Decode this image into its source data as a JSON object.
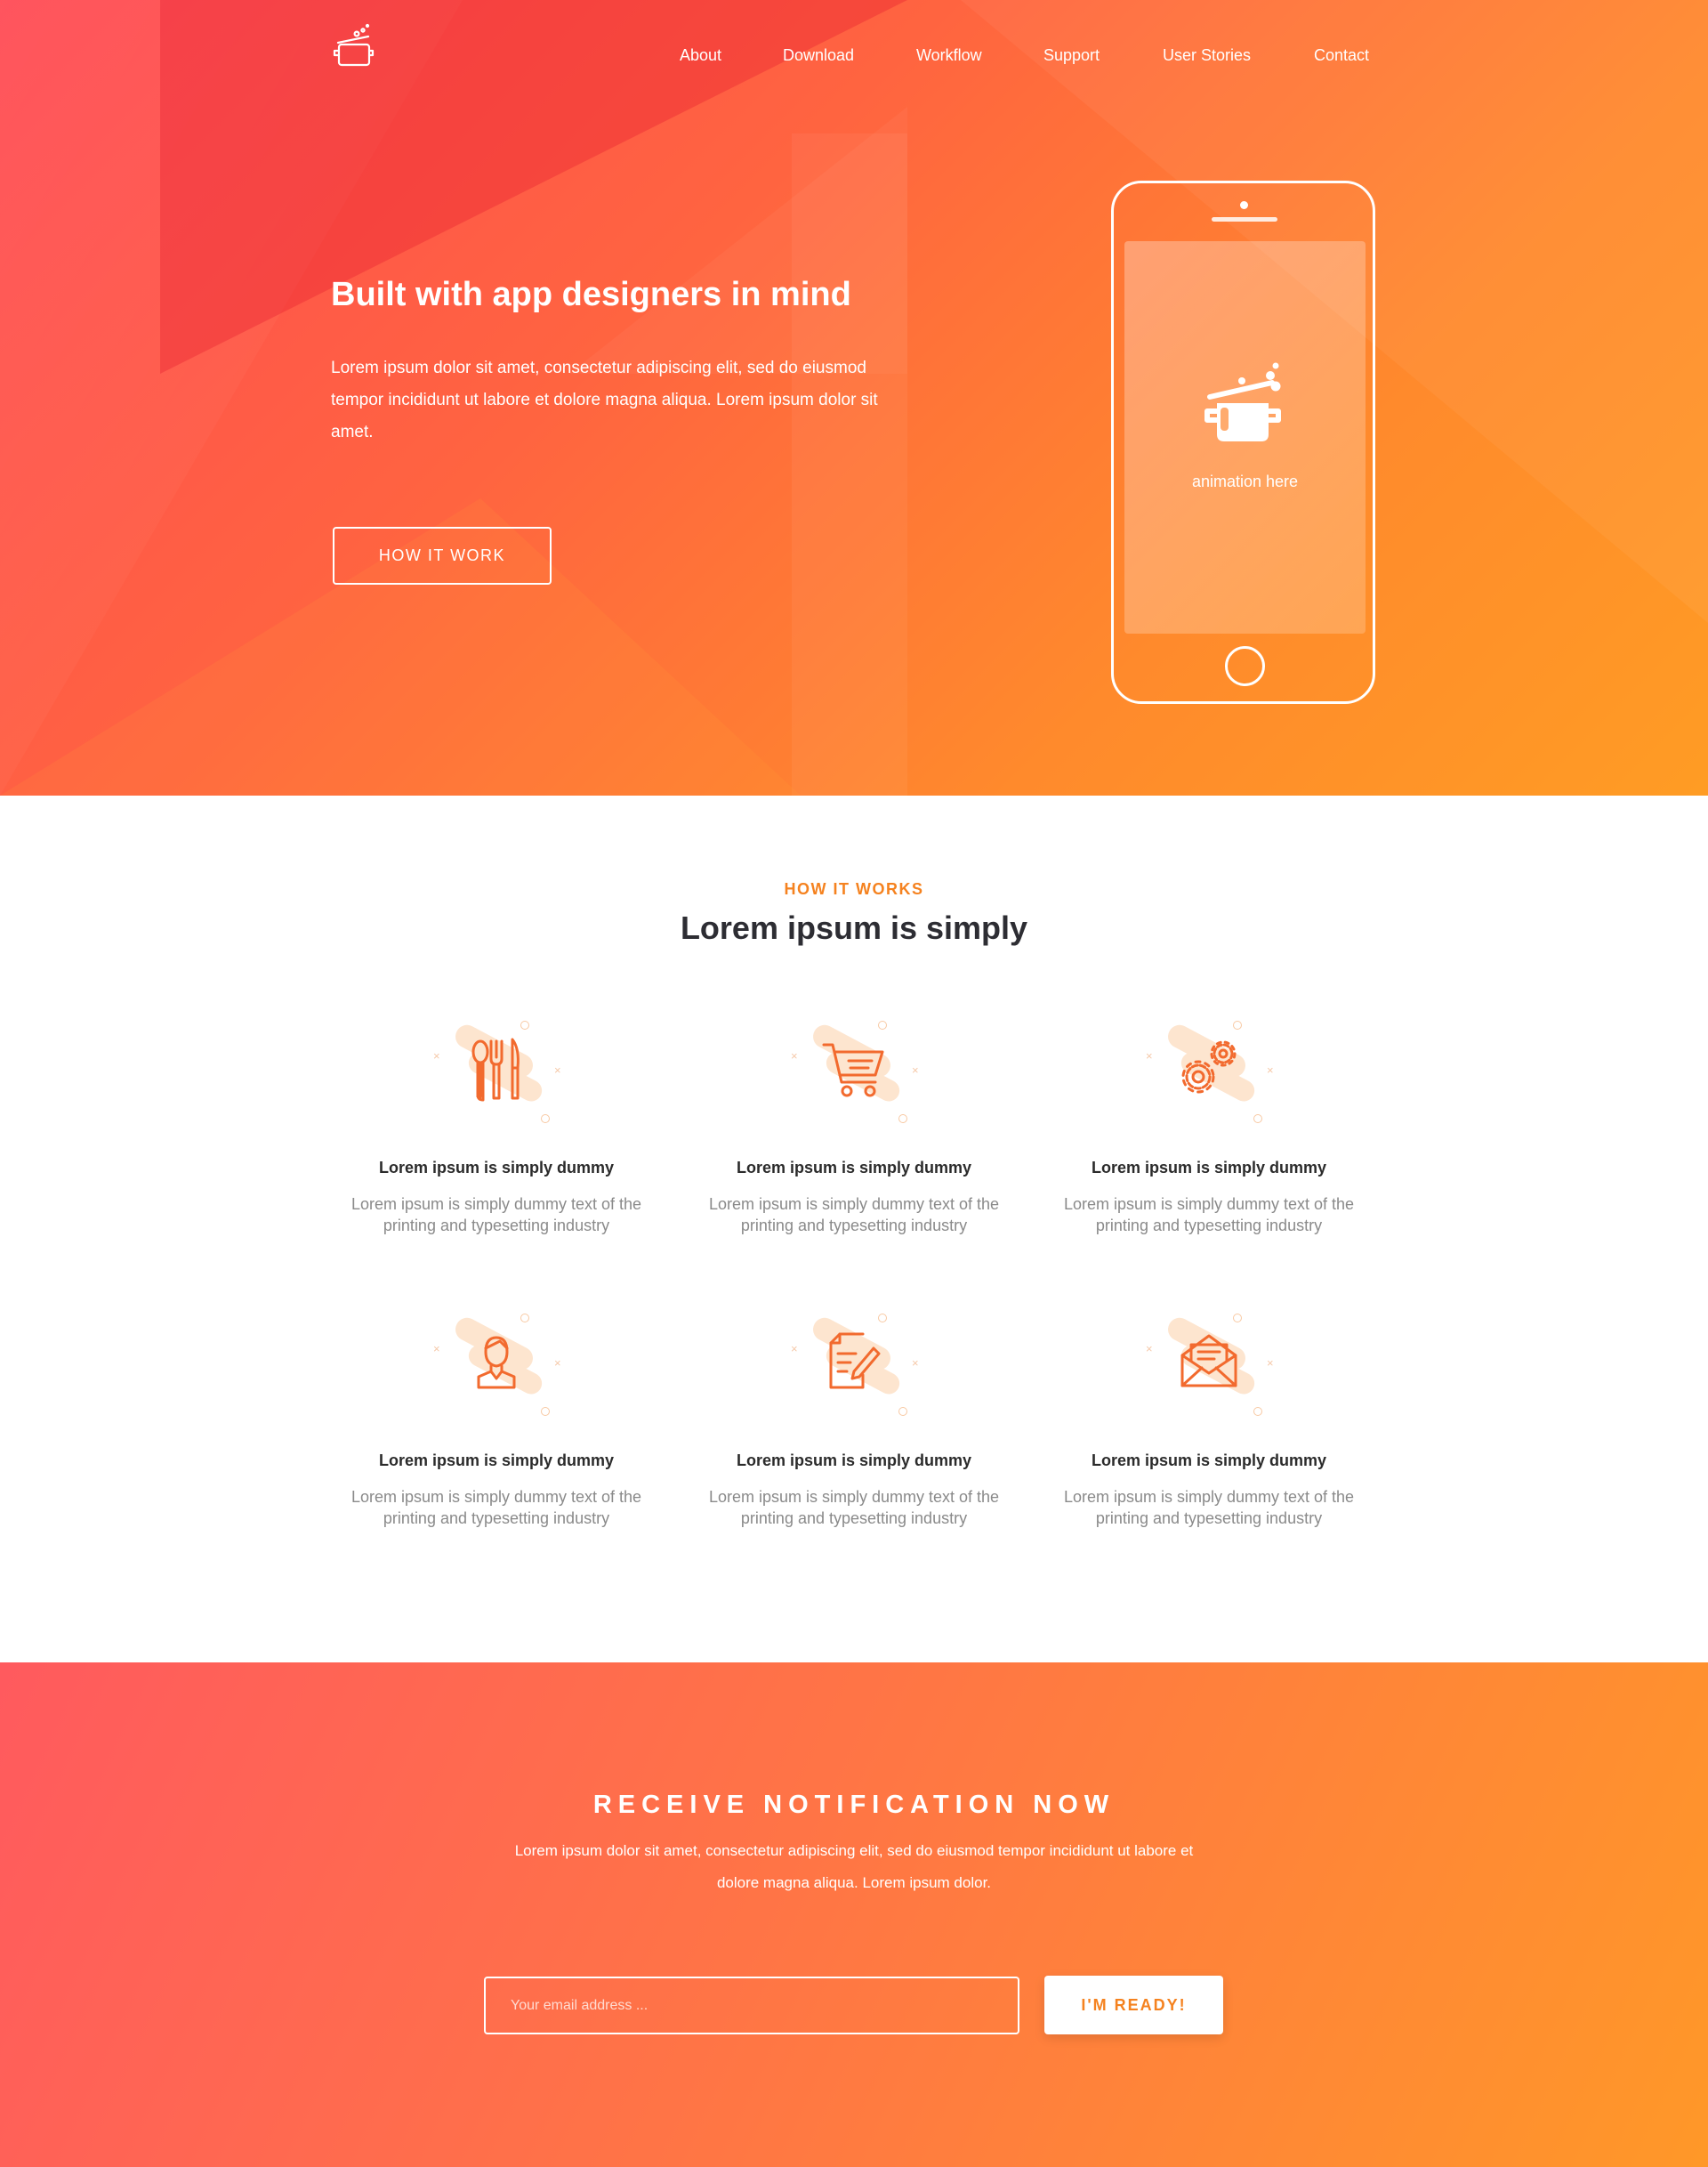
{
  "header": {
    "logo_icon": "cooking-pot-icon",
    "nav": [
      {
        "label": "About"
      },
      {
        "label": "Download"
      },
      {
        "label": "Workflow"
      },
      {
        "label": "Support"
      },
      {
        "label": "User Stories"
      },
      {
        "label": "Contact"
      }
    ]
  },
  "hero": {
    "title": "Built with app designers in mind",
    "text": "Lorem ipsum dolor sit amet, consectetur adipiscing elit, sed do eiusmod tempor incididunt ut labore et dolore magna aliqua. Lorem ipsum dolor sit amet.",
    "button_label": "HOW IT WORK",
    "phone": {
      "screen_icon": "cooking-pot-icon",
      "screen_text": "animation here"
    }
  },
  "how": {
    "eyebrow": "HOW IT WORKS",
    "title": "Lorem ipsum is simply",
    "features": [
      {
        "icon": "cutlery-icon",
        "title": "Lorem ipsum is simply dummy",
        "text": "Lorem ipsum is simply dummy text of the printing and typesetting industry"
      },
      {
        "icon": "shopping-cart-icon",
        "title": "Lorem ipsum is simply dummy",
        "text": "Lorem ipsum is simply dummy text of the printing and typesetting industry"
      },
      {
        "icon": "gears-icon",
        "title": "Lorem ipsum is simply dummy",
        "text": "Lorem ipsum is simply dummy text of the printing and typesetting industry"
      },
      {
        "icon": "user-icon",
        "title": "Lorem ipsum is simply dummy",
        "text": "Lorem ipsum is simply dummy text of the printing and typesetting industry"
      },
      {
        "icon": "document-edit-icon",
        "title": "Lorem ipsum is simply dummy",
        "text": "Lorem ipsum is simply dummy text of the printing and typesetting industry"
      },
      {
        "icon": "open-envelope-icon",
        "title": "Lorem ipsum is simply dummy",
        "text": "Lorem ipsum is simply dummy text of the printing and typesetting industry"
      }
    ]
  },
  "notify": {
    "title": "RECEIVE NOTIFICATION NOW",
    "text": "Lorem ipsum dolor sit amet, consectetur adipiscing elit, sed do eiusmod tempor incididunt ut labore et dolore magna aliqua. Lorem ipsum dolor.",
    "email_placeholder": "Your email address ...",
    "email_value": "",
    "button_label": "I'M READY!"
  },
  "colors": {
    "accent": "#f5821f",
    "hero_gradient_start": "#ff4a54",
    "hero_gradient_end": "#ff9c24",
    "icon_stroke": "#f26a2e",
    "heading": "#2d2d33",
    "body_text": "#8a8a8a"
  }
}
